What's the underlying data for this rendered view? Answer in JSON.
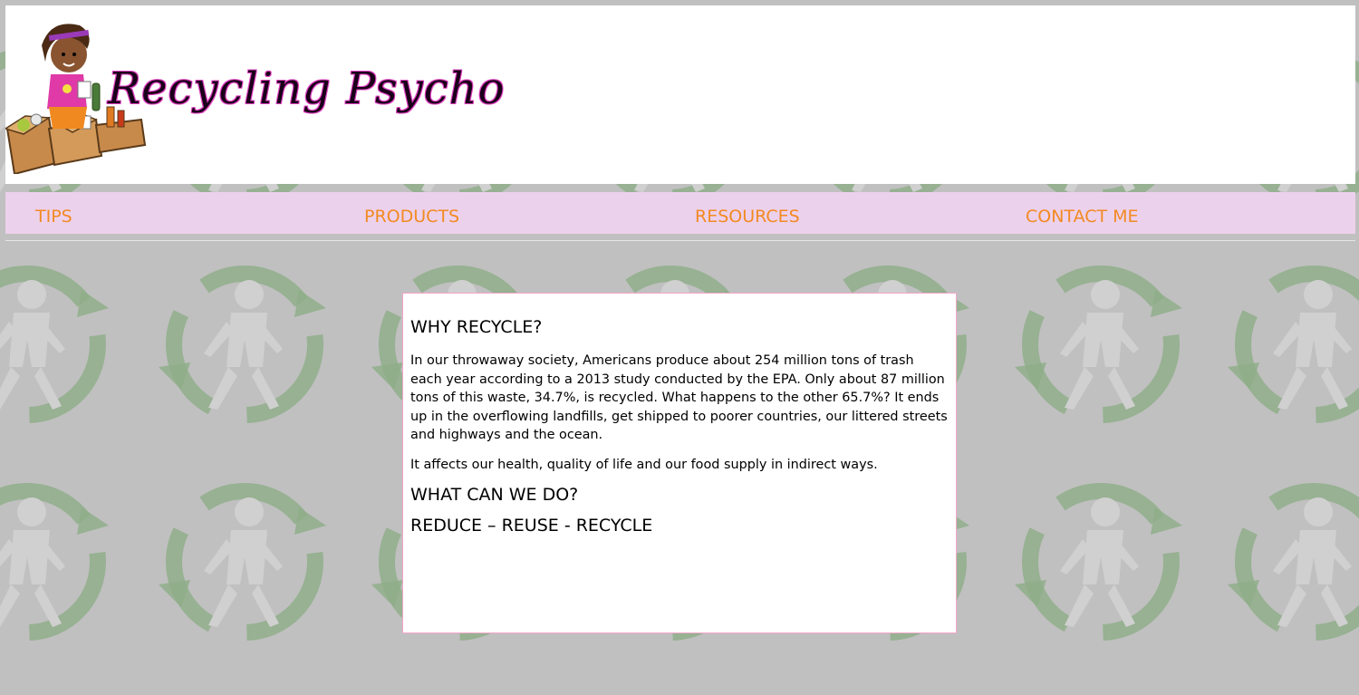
{
  "site": {
    "title": "Recycling Psycho"
  },
  "nav": {
    "items": [
      {
        "label": "TIPS"
      },
      {
        "label": "PRODUCTS"
      },
      {
        "label": "RESOURCES"
      },
      {
        "label": "CONTACT ME"
      }
    ]
  },
  "main": {
    "heading1": "WHY RECYCLE?",
    "paragraph1": "In our throwaway society, Americans produce about 254 million tons of trash each year according to a 2013 study conducted by the EPA. Only about 87 million tons of this waste, 34.7%, is recycled. What happens to the other 65.7%? It ends up in the overflowing landfills, get shipped to poorer countries, our littered streets and highways and the ocean.",
    "paragraph2": "It affects our health, quality of life and our food supply in indirect ways.",
    "heading2": "WHAT CAN WE DO?",
    "slogan": "REDUCE – REUSE - RECYCLE"
  },
  "colors": {
    "background": "#c0c0c0",
    "nav_background": "#ecd1ec",
    "nav_text": "#f28a22",
    "content_border": "#f3a6c8",
    "recycle_arrow": "#8fae8a"
  },
  "icons": {
    "logo": "recycling-girl-logo-icon",
    "background_pattern": "recycling-figure-icon"
  }
}
